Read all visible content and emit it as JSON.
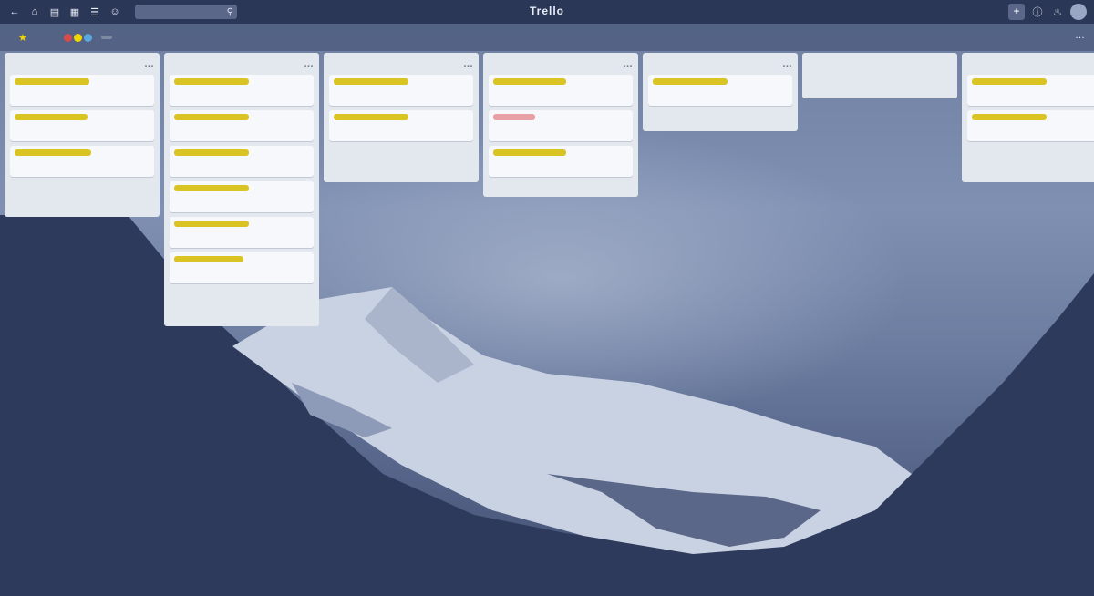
{
  "topbar": {
    "search_icon": "search-icon",
    "brand": "Trello"
  },
  "colors": {
    "label_yellow": "#d9c424",
    "label_red": "#e8a0a6",
    "member_colors": [
      "#d94a4a",
      "#f2d600",
      "#5aa8e0",
      "#7bc86c"
    ]
  },
  "lists": [
    {
      "cards": [
        {
          "label": "yellow",
          "label_width": 82
        },
        {
          "label": "yellow",
          "label_width": 80
        },
        {
          "label": "yellow",
          "label_width": 84
        }
      ]
    },
    {
      "cards": [
        {
          "label": "yellow",
          "label_width": 82
        },
        {
          "label": "yellow",
          "label_width": 82
        },
        {
          "label": "yellow",
          "label_width": 82
        },
        {
          "label": "yellow",
          "label_width": 82
        },
        {
          "label": "yellow",
          "label_width": 82
        },
        {
          "label": "yellow",
          "label_width": 76
        }
      ]
    },
    {
      "cards": [
        {
          "label": "yellow",
          "label_width": 82
        },
        {
          "label": "yellow",
          "label_width": 82
        }
      ]
    },
    {
      "cards": [
        {
          "label": "yellow",
          "label_width": 80
        },
        {
          "label": "red",
          "label_width": 46
        },
        {
          "label": "yellow",
          "label_width": 80
        }
      ]
    },
    {
      "cards": [
        {
          "label": "yellow",
          "label_width": 82
        }
      ]
    },
    {
      "cards": []
    },
    {
      "cards": [
        {
          "label": "yellow",
          "label_width": 82
        },
        {
          "label": "yellow",
          "label_width": 82
        }
      ]
    }
  ]
}
